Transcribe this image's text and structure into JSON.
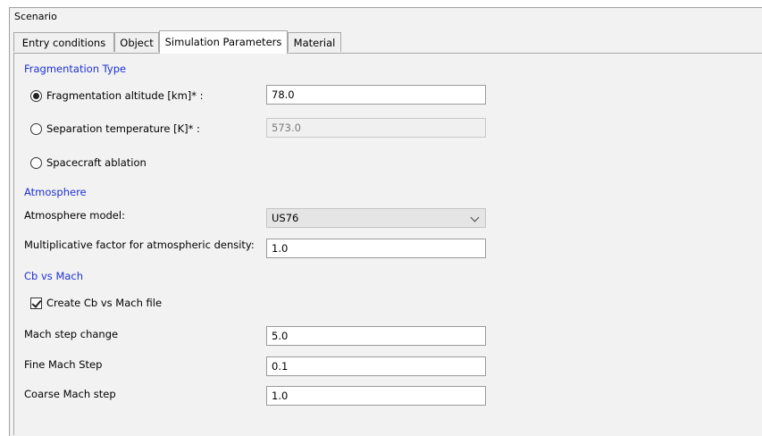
{
  "scenario": {
    "label": "Scenario"
  },
  "tabs": [
    {
      "label": "Entry conditions",
      "active": false
    },
    {
      "label": "Object",
      "active": false
    },
    {
      "label": "Simulation Parameters",
      "active": true
    },
    {
      "label": "Material",
      "active": false
    }
  ],
  "fragmentation": {
    "section_title": "Fragmentation Type",
    "altitude": {
      "label": "Fragmentation altitude [km]* :",
      "value": "78.0",
      "selected": true
    },
    "separation": {
      "label": "Separation temperature [K]* :",
      "value": "573.0",
      "selected": false
    },
    "ablation": {
      "label": "Spacecraft ablation",
      "selected": false
    }
  },
  "atmosphere": {
    "section_title": "Atmosphere",
    "model_label": "Atmosphere model:",
    "model_value": "US76",
    "factor_label": "Multiplicative factor for atmospheric density:",
    "factor_value": "1.0"
  },
  "cb_mach": {
    "section_title": "Cb vs Mach",
    "create_label": "Create Cb vs Mach file",
    "create_checked": true,
    "step_change_label": "Mach step change",
    "step_change_value": "5.0",
    "fine_step_label": "Fine Mach Step",
    "fine_step_value": "0.1",
    "coarse_step_label": "Coarse Mach step",
    "coarse_step_value": "1.0"
  },
  "colors": {
    "section_title": "#1e32d6",
    "panel_background": "#f2f2f2",
    "border": "#a8a8a8"
  }
}
